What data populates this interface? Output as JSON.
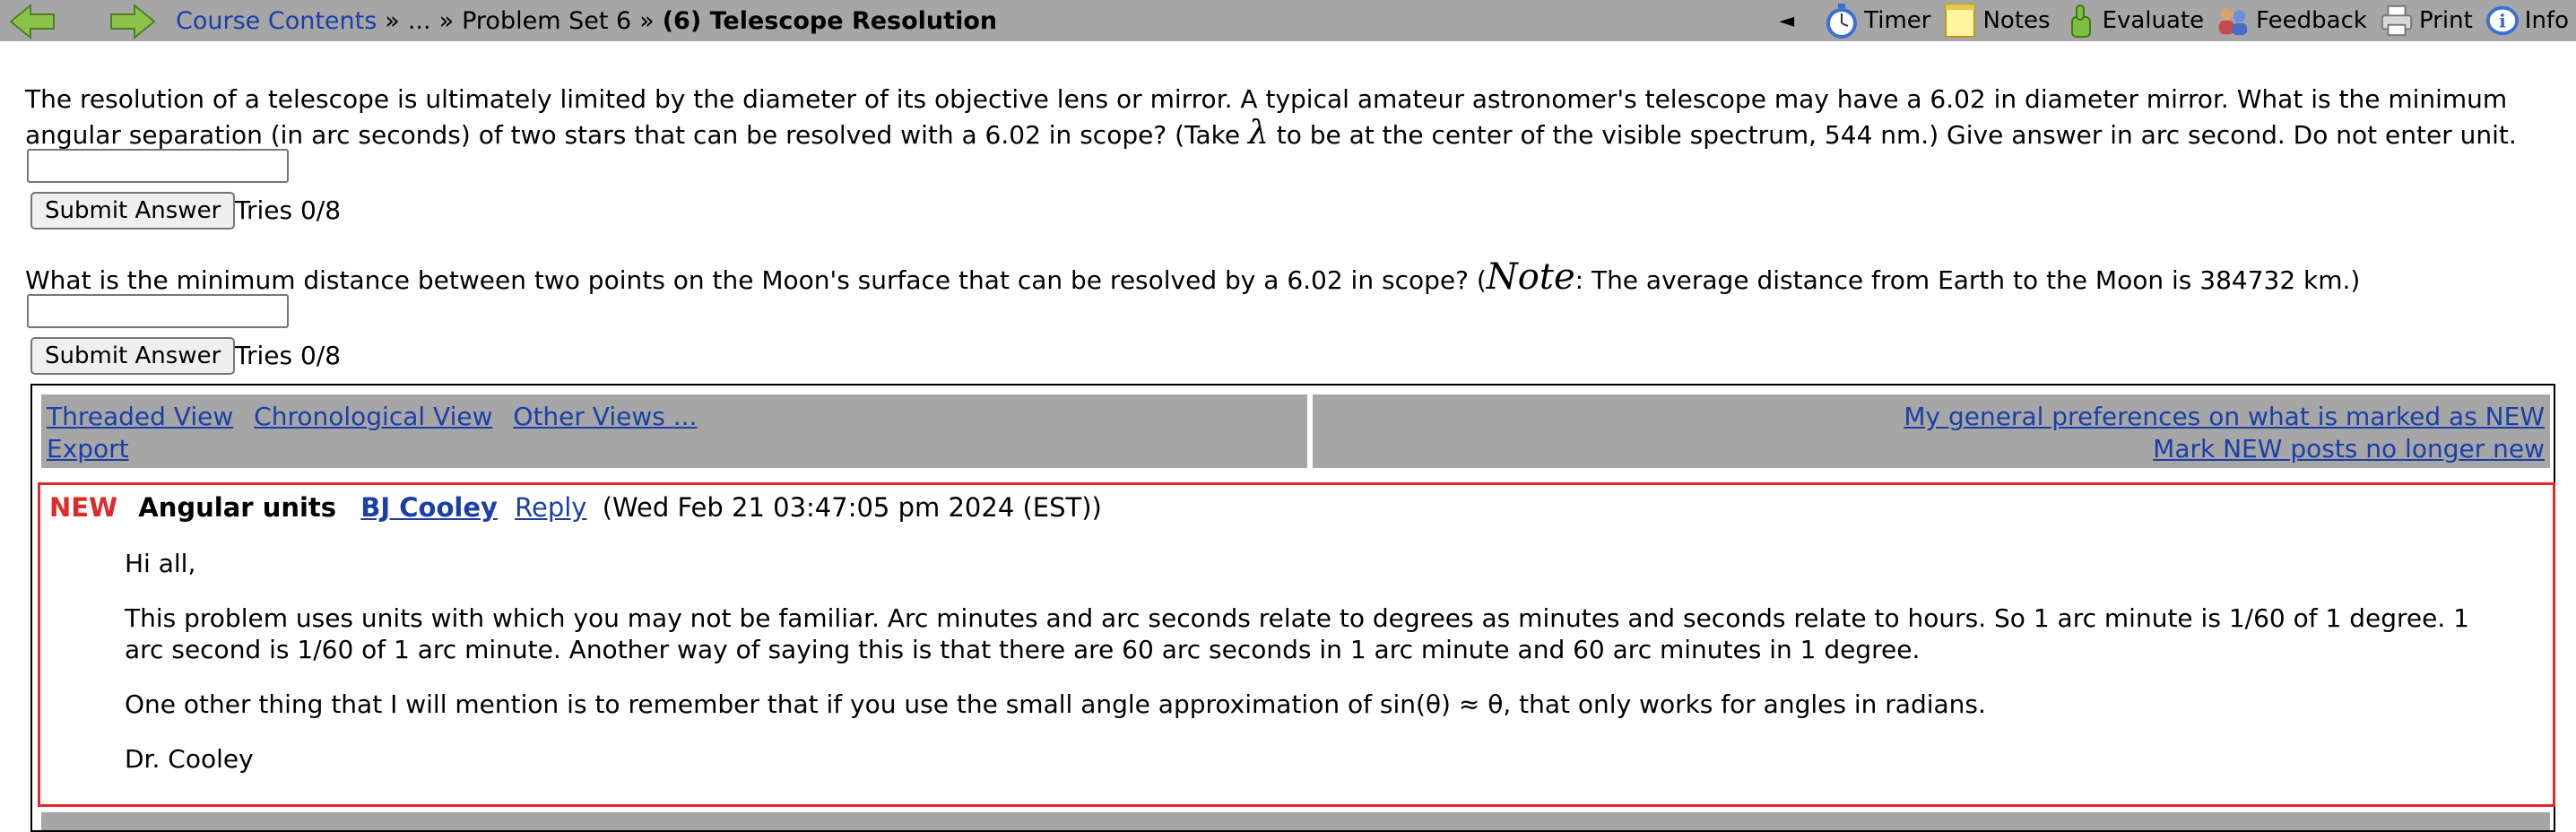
{
  "topbar": {
    "breadcrumb": {
      "course_contents": "Course Contents",
      "sep1": "»",
      "ellipsis": "...",
      "sep2": "»",
      "problem_set": "Problem Set 6",
      "sep3": "»",
      "current": "(6) Telescope Resolution"
    },
    "tools": {
      "collapse": "◄",
      "timer": "Timer",
      "notes": "Notes",
      "evaluate": "Evaluate",
      "feedback": "Feedback",
      "print": "Print",
      "info": "Info"
    }
  },
  "question1": {
    "text_before": "The resolution of a telescope is ultimately limited by the diameter of its objective lens or mirror. A typical amateur astronomer's telescope may have a 6.02 in diameter mirror. What is the minimum angular separation (in arc seconds) of two stars that can be resolved with a 6.02 in scope? (Take",
    "symbol": "λ",
    "text_after": "to be at the center of the visible spectrum, 544 nm.) Give answer in arc second. Do not enter unit.",
    "input_value": "",
    "submit_label": "Submit Answer",
    "tries": "Tries 0/8"
  },
  "question2": {
    "text_before": "What is the minimum distance between two points on the Moon's surface that can be resolved by a 6.02 in scope? (",
    "note_word": "Note",
    "text_after": ": The average distance from Earth to the Moon is 384732 km.)",
    "input_value": "",
    "submit_label": "Submit Answer",
    "tries": "Tries 0/8"
  },
  "forum": {
    "threaded_view": "Threaded View",
    "chronological_view": "Chronological View",
    "other_views": "Other Views ...",
    "export": "Export",
    "preferences": "My general preferences on what is marked as NEW",
    "mark_no_longer_new": "Mark NEW posts no longer new",
    "post": {
      "new_flag": "NEW",
      "subject": "Angular units",
      "author": "BJ Cooley",
      "reply": "Reply",
      "date": "(Wed Feb 21 03:47:05 pm 2024 (EST))",
      "greeting": "Hi all,",
      "para1": "This problem uses units with which you may not be familiar. Arc minutes and arc seconds relate to degrees as minutes and seconds relate to hours. So 1 arc minute is 1/60 of 1 degree. 1 arc second is 1/60 of 1 arc minute. Another way of saying this is that there are 60 arc seconds in 1 arc minute and 60 arc minutes in 1 degree.",
      "para2": "One other thing that I will mention is to remember that if you use the small angle approximation of sin(θ) ≈ θ, that only works for angles in radians.",
      "signature": "Dr. Cooley"
    }
  },
  "colors": {
    "bar_gray": "#a6a6a6",
    "link_blue": "#1a3fa8",
    "new_red": "#e02a2a",
    "arrow_green": "#8bc34a"
  }
}
